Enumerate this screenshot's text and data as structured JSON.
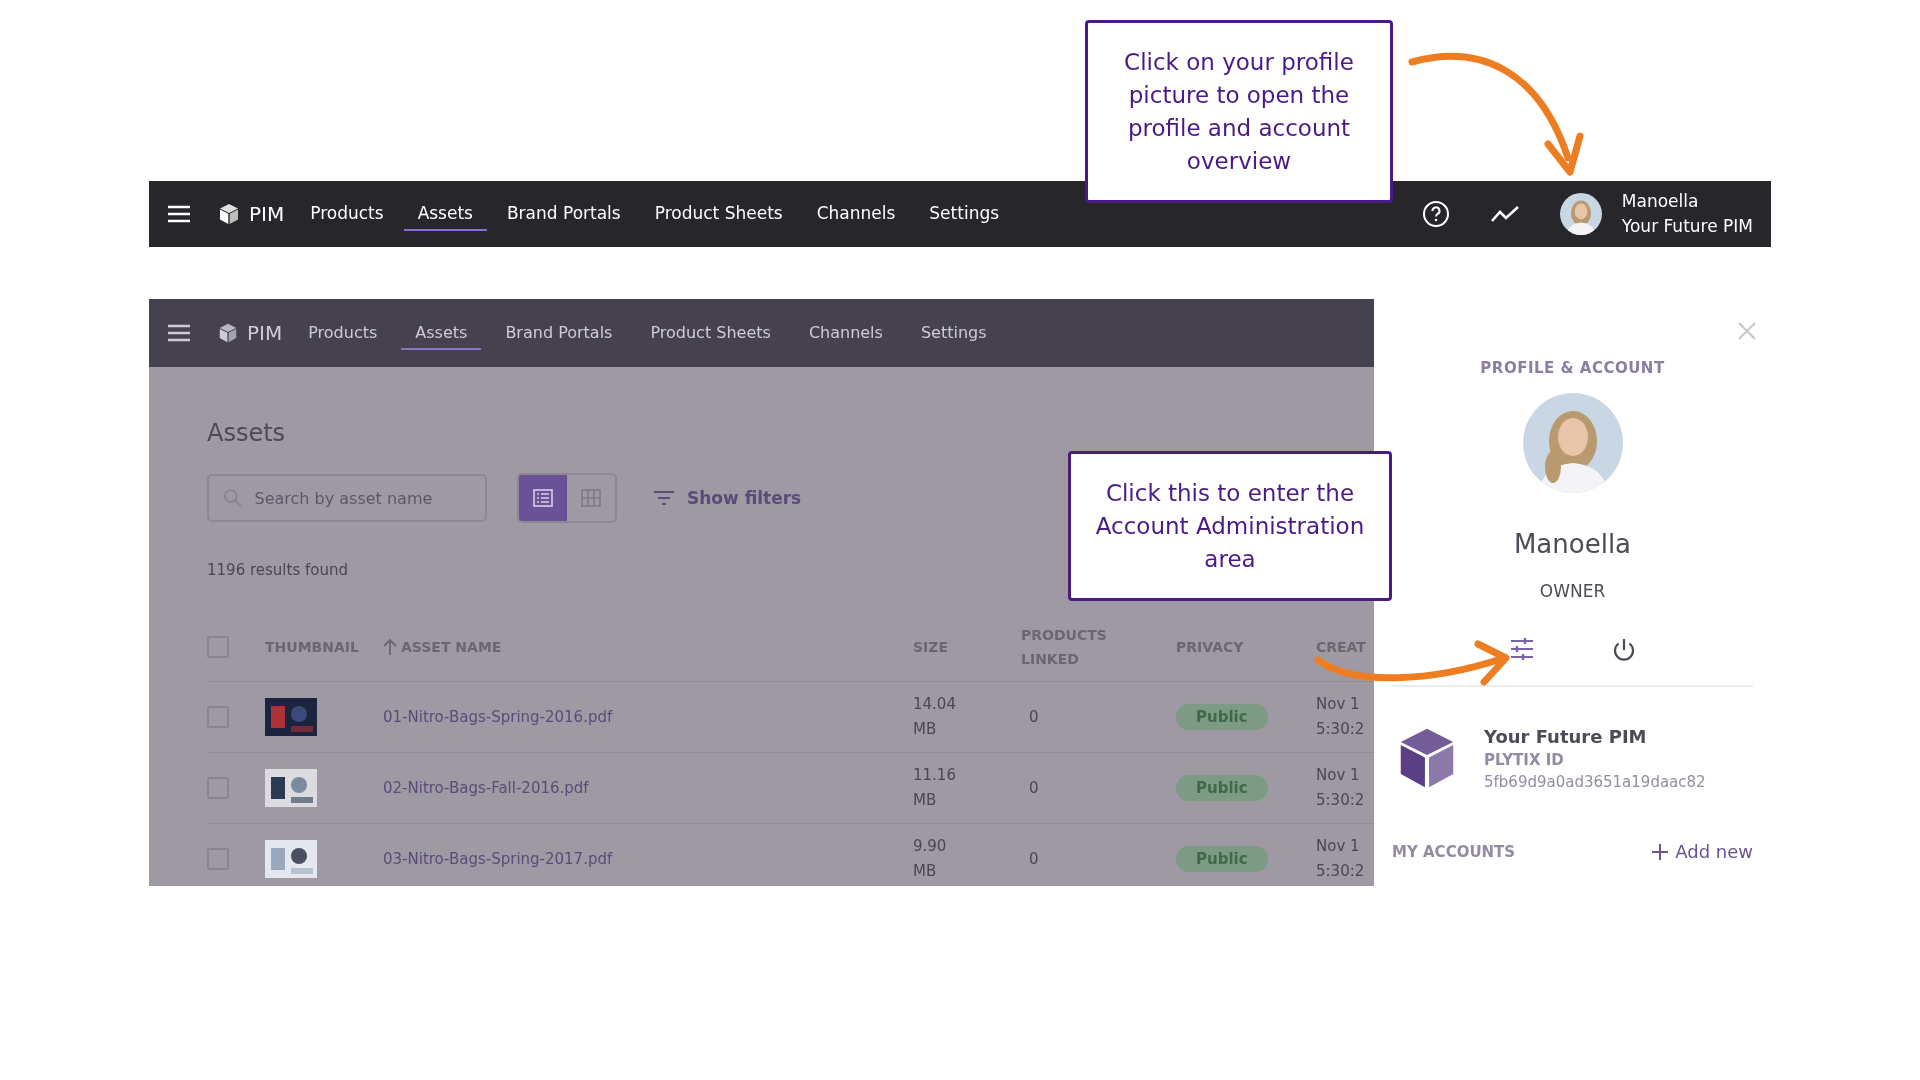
{
  "top_bar": {
    "logo": "PIM",
    "nav": [
      {
        "label": "Products",
        "selected": false
      },
      {
        "label": "Assets",
        "selected": true
      },
      {
        "label": "Brand Portals",
        "selected": false
      },
      {
        "label": "Product Sheets",
        "selected": false
      },
      {
        "label": "Channels",
        "selected": false
      },
      {
        "label": "Settings",
        "selected": false
      }
    ],
    "user": {
      "name": "Manoella",
      "account": "Your Future PIM"
    }
  },
  "callouts": [
    "Click on your profile picture to open the profile and account overview",
    "Click this to enter the Account Administration area"
  ],
  "app": {
    "logo": "PIM",
    "nav": [
      {
        "label": "Products",
        "selected": false
      },
      {
        "label": "Assets",
        "selected": true
      },
      {
        "label": "Brand Portals",
        "selected": false
      },
      {
        "label": "Product Sheets",
        "selected": false
      },
      {
        "label": "Channels",
        "selected": false
      },
      {
        "label": "Settings",
        "selected": false
      }
    ],
    "page_title": "Assets",
    "search": {
      "placeholder": "Search by asset name"
    },
    "view_modes": [
      {
        "kind": "list",
        "selected": true
      },
      {
        "kind": "grid",
        "selected": false
      }
    ],
    "filters_button": "Show filters",
    "results": "1196 results found",
    "table": {
      "select_all": {
        "checked": false
      },
      "columns": [
        {
          "label": "THUMBNAIL",
          "sorted": false
        },
        {
          "label": "ASSET NAME",
          "sorted": true
        },
        {
          "label": "SIZE",
          "sorted": false
        },
        {
          "label": "PRODUCTS LINKED",
          "sorted": false
        },
        {
          "label": "PRIVACY",
          "sorted": false
        },
        {
          "label": "CREAT",
          "sorted": false
        }
      ],
      "rows": [
        {
          "checked": false,
          "name": "01-Nitro-Bags-Spring-2016.pdf",
          "size": "14.04 MB",
          "products": "0",
          "privacy": "Public",
          "created": [
            "Nov 1",
            "5:30:2"
          ]
        },
        {
          "checked": false,
          "name": "02-Nitro-Bags-Fall-2016.pdf",
          "size": "11.16 MB",
          "products": "0",
          "privacy": "Public",
          "created": [
            "Nov 1",
            "5:30:2"
          ]
        },
        {
          "checked": false,
          "name": "03-Nitro-Bags-Spring-2017.pdf",
          "size": "9.90 MB",
          "products": "0",
          "privacy": "Public",
          "created": [
            "Nov 1",
            "5:30:2"
          ]
        }
      ]
    }
  },
  "profile_panel": {
    "heading": "PROFILE & ACCOUNT",
    "name": "Manoella",
    "role": "OWNER",
    "account": {
      "name": "Your Future PIM",
      "id_label": "PLYTIX ID",
      "id": "5fb69d9a0ad3651a19daac82"
    },
    "my_accounts": "MY ACCOUNTS",
    "add_new": "Add new"
  }
}
